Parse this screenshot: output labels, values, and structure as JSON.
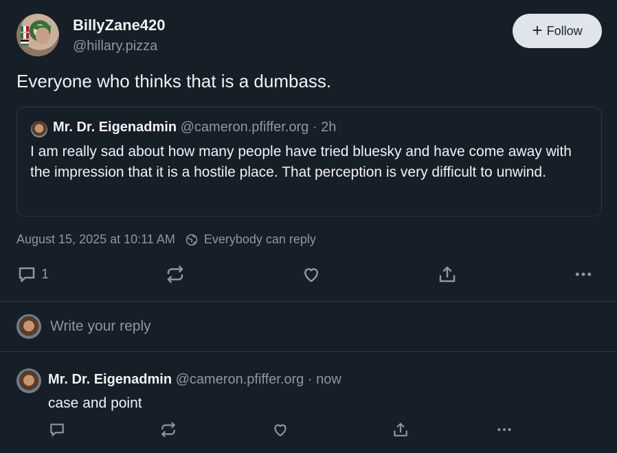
{
  "post": {
    "display_name": "BillyZane420",
    "handle": "@hillary.pizza",
    "follow_label": "Follow",
    "text": "Everyone who thinks that is a dumbass.",
    "timestamp": "August 15, 2025 at 10:11 AM",
    "reply_setting": "Everybody can reply",
    "reply_count": "1"
  },
  "quote": {
    "display_name": "Mr. Dr. Eigenadmin",
    "meta": "@cameron.pfiffer.org · 2h",
    "text": "I am really sad about how many people have tried bluesky and have come away with the impression that it is a hostile place. That perception is very difficult to unwind."
  },
  "compose": {
    "placeholder": "Write your reply"
  },
  "reply": {
    "display_name": "Mr. Dr. Eigenadmin",
    "meta": "@cameron.pfiffer.org · now",
    "text": "case and point"
  },
  "icons": {
    "follow": "plus-icon",
    "reply": "speech-bubble-icon",
    "repost": "repost-icon",
    "like": "heart-icon",
    "share": "share-icon",
    "more": "more-dots-icon",
    "reply_setting": "globe-icon"
  },
  "colors": {
    "background": "#161e27",
    "text_primary": "#f1f3f5",
    "text_secondary": "#8b98a8",
    "border": "#2c3846",
    "follow_button_bg": "#dfe5eb"
  }
}
